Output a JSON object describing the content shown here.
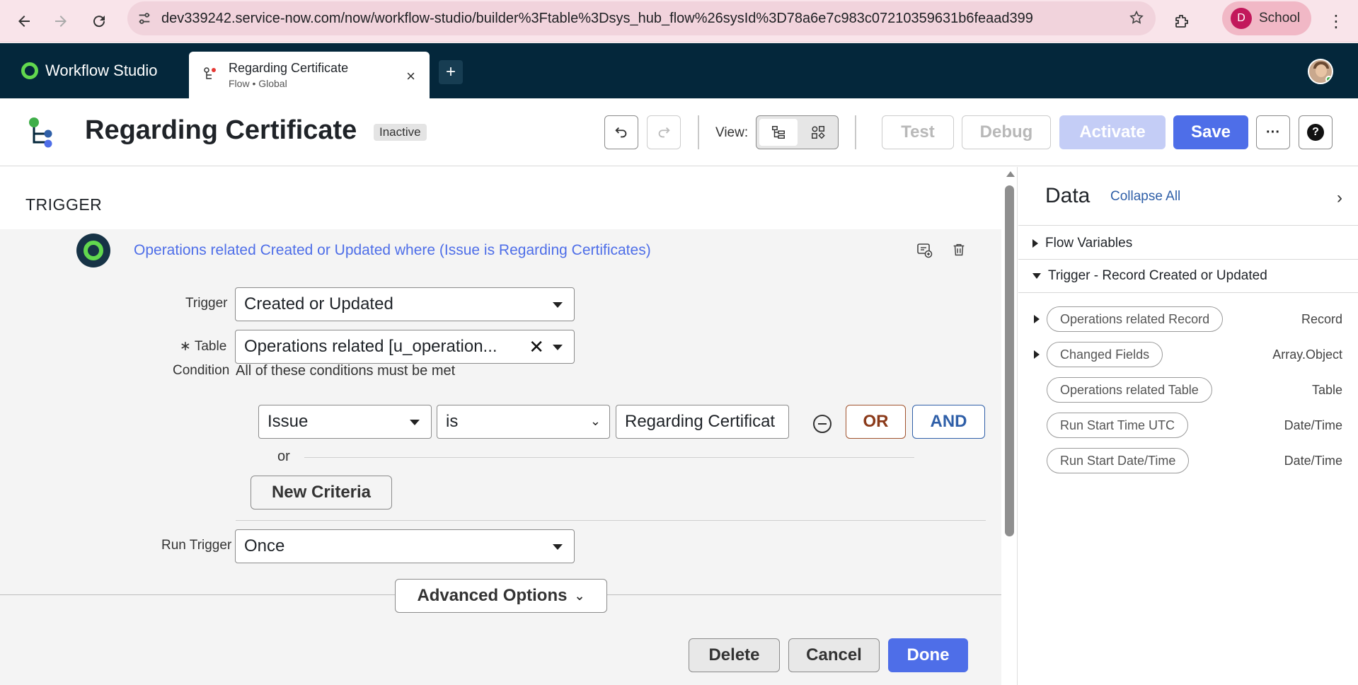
{
  "browser": {
    "url": "dev339242.service-now.com/now/workflow-studio/builder%3Ftable%3Dsys_hub_flow%26sysId%3D78a6e7c983c07210359631b6feaad399",
    "profile_initial": "D",
    "profile_label": "School"
  },
  "app": {
    "brand": "Workflow Studio",
    "tab": {
      "title": "Regarding Certificate",
      "subtitle": "Flow • Global"
    },
    "colors": {
      "header": "#04273b",
      "accent": "#4e6ee8",
      "brand_green": "#62d84e"
    }
  },
  "flow": {
    "title": "Regarding Certificate",
    "status": "Inactive",
    "view_label": "View:",
    "buttons": {
      "test": "Test",
      "debug": "Debug",
      "activate": "Activate",
      "save": "Save",
      "more": "···",
      "help": "?"
    }
  },
  "trigger": {
    "heading": "TRIGGER",
    "summary": "Operations related Created or Updated where (Issue is Regarding Certificates)",
    "trigger_label": "Trigger",
    "trigger_value": "Created or Updated",
    "table_required": "∗",
    "table_label": "Table",
    "table_value": "Operations related [u_operation...",
    "condition_label": "Condition",
    "condition_text": "All of these conditions must be met",
    "condition": {
      "field": "Issue",
      "operator": "is",
      "value": "Regarding Certificat"
    },
    "or_button": "OR",
    "and_button": "AND",
    "or_text": "or",
    "new_criteria": "New Criteria",
    "run_trigger_label": "Run Trigger",
    "run_trigger_value": "Once",
    "advanced_options": "Advanced Options",
    "delete": "Delete",
    "cancel": "Cancel",
    "done": "Done"
  },
  "data_panel": {
    "title": "Data",
    "collapse_all": "Collapse All",
    "flow_variables": "Flow Variables",
    "trigger_section": "Trigger - Record Created or Updated",
    "pills": [
      {
        "label": "Operations related Record",
        "type": "Record",
        "expandable": true
      },
      {
        "label": "Changed Fields",
        "type": "Array.Object",
        "expandable": true
      },
      {
        "label": "Operations related Table",
        "type": "Table",
        "expandable": false
      },
      {
        "label": "Run Start Time UTC",
        "type": "Date/Time",
        "expandable": false
      },
      {
        "label": "Run Start Date/Time",
        "type": "Date/Time",
        "expandable": false
      }
    ]
  }
}
